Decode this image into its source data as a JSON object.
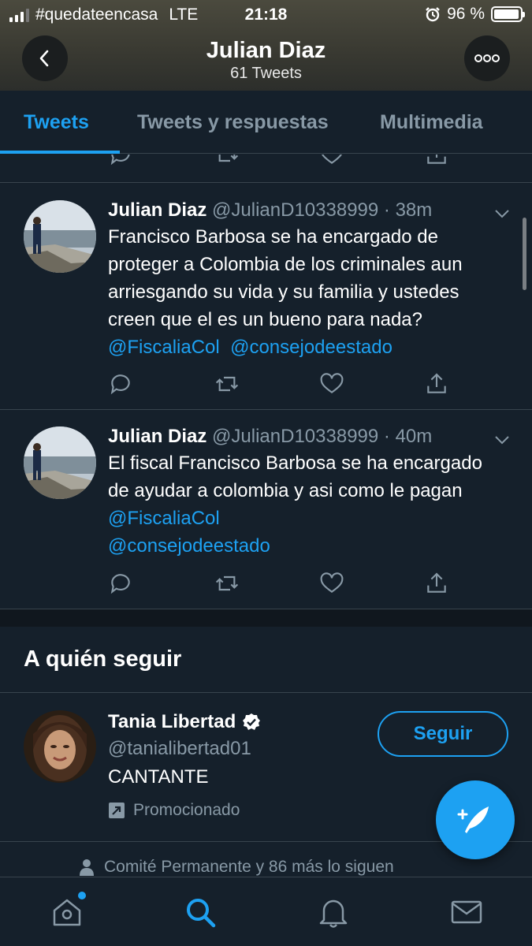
{
  "status_bar": {
    "carrier": "#quedateencasa",
    "network": "LTE",
    "time": "21:18",
    "battery": "96 %",
    "battery_level": 0.96
  },
  "header": {
    "title": "Julian Diaz",
    "subtitle": "61 Tweets",
    "back_icon": "chevron-left-icon",
    "more_icon": "more-dots-icon"
  },
  "tabs": [
    {
      "label": "Tweets",
      "active": true
    },
    {
      "label": "Tweets y respuestas",
      "active": false
    },
    {
      "label": "Multimedia",
      "active": false
    }
  ],
  "tweets": [
    {
      "name": "Julian Diaz",
      "handle": "@JulianD10338999",
      "time": "38m",
      "text": "Francisco Barbosa se ha encargado de proteger a Colombia de los criminales aun arriesgando su vida y su familia y ustedes creen que el es un bueno para nada?",
      "mentions": [
        "@FiscaliaCol",
        "@consejodeestado"
      ]
    },
    {
      "name": "Julian Diaz",
      "handle": "@JulianD10338999",
      "time": "40m",
      "text": "El fiscal Francisco Barbosa se ha encargado de ayudar a colombia y asi como le pagan",
      "mentions": [
        "@FiscaliaCol",
        "@consejodeestado"
      ]
    }
  ],
  "who_to_follow": {
    "heading": "A quién seguir",
    "suggestion": {
      "name": "Tania Libertad",
      "handle": "@tanialibertad01",
      "bio": "CANTANTE",
      "promoted": "Promocionado",
      "follow_label": "Seguir",
      "verified": true
    },
    "followers_text": "Comité Permanente y 86 más lo siguen"
  },
  "colors": {
    "accent": "#1da1f2",
    "background": "#15202b",
    "secondary_text": "#8899a6",
    "divider": "#38444d"
  },
  "tab_bar": [
    "home-icon",
    "search-icon",
    "bell-icon",
    "mail-icon"
  ]
}
